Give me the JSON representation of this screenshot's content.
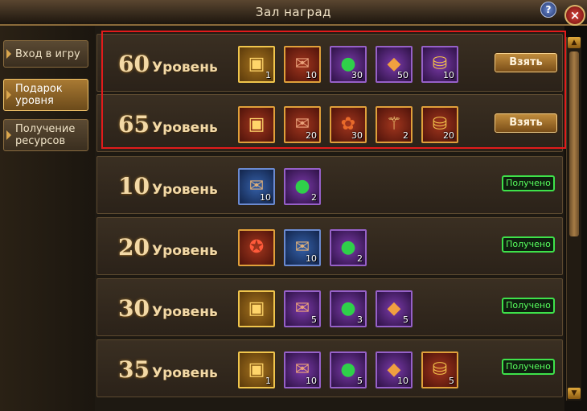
{
  "window": {
    "title": "Зал наград",
    "help_icon": "?",
    "close_icon": "×"
  },
  "sidebar": {
    "items": [
      {
        "label": "Вход в игру",
        "active": false
      },
      {
        "label": "Подарок уровня",
        "active": true
      },
      {
        "label": "Получение ресурсов",
        "active": false
      }
    ]
  },
  "labels": {
    "take": "Взять",
    "received": "Получено",
    "level_word": "Уровень"
  },
  "rows": [
    {
      "level": "60",
      "status": "take",
      "items": [
        {
          "icon": "treasure-chest-icon",
          "glyph": "▣",
          "count": "1",
          "style": "gold"
        },
        {
          "icon": "scroll-icon",
          "glyph": "✉",
          "count": "10",
          "style": "red"
        },
        {
          "icon": "green-gem-icon",
          "glyph": "●",
          "count": "30",
          "style": "purple"
        },
        {
          "icon": "orange-crystal-icon",
          "glyph": "◆",
          "count": "50",
          "style": "purple"
        },
        {
          "icon": "gold-coins-icon",
          "glyph": "⛁",
          "count": "10",
          "style": "purple"
        }
      ]
    },
    {
      "level": "65",
      "status": "take",
      "items": [
        {
          "icon": "treasure-chest-icon",
          "glyph": "▣",
          "count": "",
          "style": "red"
        },
        {
          "icon": "scroll-icon",
          "glyph": "✉",
          "count": "20",
          "style": "red"
        },
        {
          "icon": "pumpkin-icon",
          "glyph": "✿",
          "count": "30",
          "style": "red"
        },
        {
          "icon": "staff-icon",
          "glyph": "⚚",
          "count": "2",
          "style": "red"
        },
        {
          "icon": "gold-coins-icon",
          "glyph": "⛁",
          "count": "20",
          "style": "red"
        }
      ]
    },
    {
      "level": "10",
      "status": "received",
      "items": [
        {
          "icon": "blue-scroll-icon",
          "glyph": "✉",
          "count": "10",
          "style": "blue"
        },
        {
          "icon": "green-gem-icon",
          "glyph": "●",
          "count": "2",
          "style": "purple"
        }
      ]
    },
    {
      "level": "20",
      "status": "received",
      "items": [
        {
          "icon": "emblem-icon",
          "glyph": "✪",
          "count": "",
          "style": "red"
        },
        {
          "icon": "blue-scroll-icon",
          "glyph": "✉",
          "count": "10",
          "style": "blue"
        },
        {
          "icon": "green-gem-icon",
          "glyph": "●",
          "count": "2",
          "style": "purple"
        }
      ]
    },
    {
      "level": "30",
      "status": "received",
      "items": [
        {
          "icon": "treasure-chest-icon",
          "glyph": "▣",
          "count": "",
          "style": "gold"
        },
        {
          "icon": "scroll-icon",
          "glyph": "✉",
          "count": "5",
          "style": "purple"
        },
        {
          "icon": "green-gem-icon",
          "glyph": "●",
          "count": "3",
          "style": "purple"
        },
        {
          "icon": "orange-crystal-icon",
          "glyph": "◆",
          "count": "5",
          "style": "purple"
        }
      ]
    },
    {
      "level": "35",
      "status": "received",
      "items": [
        {
          "icon": "treasure-chest-icon",
          "glyph": "▣",
          "count": "1",
          "style": "gold"
        },
        {
          "icon": "scroll-icon",
          "glyph": "✉",
          "count": "10",
          "style": "purple"
        },
        {
          "icon": "green-gem-icon",
          "glyph": "●",
          "count": "5",
          "style": "purple"
        },
        {
          "icon": "orange-crystal-icon",
          "glyph": "◆",
          "count": "10",
          "style": "purple"
        },
        {
          "icon": "gold-coins-icon",
          "glyph": "⛁",
          "count": "5",
          "style": "red"
        }
      ]
    }
  ],
  "colors": {
    "highlight": "#e21b1b",
    "received_green": "#3ee24a",
    "take_gold": "#c08c3d",
    "gem_green": "#2fd04a",
    "crystal_orange": "#f0a040",
    "coin_gold": "#f2c04a",
    "scroll_brown": "#c86a3a"
  }
}
